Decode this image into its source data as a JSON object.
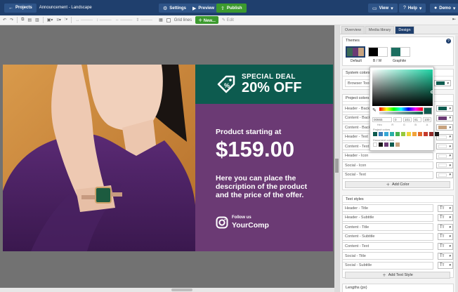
{
  "topbar": {
    "projects_label": "Projects",
    "doc_title": "Announcement - Landscape",
    "settings_label": "Settings",
    "preview_label": "Preview",
    "publish_label": "Publish",
    "view_label": "View",
    "help_label": "Help",
    "user_label": "Demo"
  },
  "toolbar": {
    "grid_lines_label": "Grid lines",
    "new_label": "New...",
    "edit_label": "Edit"
  },
  "artboard": {
    "deal_line1": "SPECIAL DEAL",
    "deal_line2": "20% OFF",
    "product_label": "Product starting at",
    "price": "$159.00",
    "description": "Here you can place the description of the product and the price of the offer.",
    "follow_label": "Follow us",
    "company": "YourComp"
  },
  "panel": {
    "tabs": [
      "Overview",
      "Media library",
      "Design"
    ],
    "active_tab": "Design",
    "themes_title": "Themes",
    "themes": [
      {
        "name": "Default"
      },
      {
        "name": "B / W"
      },
      {
        "name": "Graphite"
      }
    ],
    "system_colors_title": "System colors",
    "system_colors": [
      {
        "label": "Browser Toolba",
        "color": "#0d5b4f"
      }
    ],
    "project_colors_title": "Project colors",
    "project_colors": [
      {
        "label": "Header - Back",
        "color": "#0d5b4f"
      },
      {
        "label": "Content - Back",
        "color": "#6b3a74"
      },
      {
        "label": "Content - Back",
        "color": "#c7a27e"
      },
      {
        "label": "Header - Text",
        "color": "#ffffff"
      },
      {
        "label": "Content - Text",
        "color": "#ffffff"
      },
      {
        "label": "Header - Icon",
        "color": "#ffffff"
      },
      {
        "label": "Social - Icon",
        "color": "#ffffff"
      },
      {
        "label": "Social - Text",
        "color": "#ffffff"
      }
    ],
    "add_color_label": "Add Color",
    "text_styles_title": "Text styles",
    "text_styles": [
      {
        "label": "Header - Title"
      },
      {
        "label": "Header - Subtitle"
      },
      {
        "label": "Content - Title"
      },
      {
        "label": "Content - Subtitle"
      },
      {
        "label": "Content - Text"
      },
      {
        "label": "Social - Title"
      },
      {
        "label": "Social - Subtitle"
      }
    ],
    "add_text_style_label": "Add Text Style",
    "lengths_title": "Lengths (px)"
  },
  "color_picker": {
    "hex_value": "00665",
    "r": "0",
    "g": "101",
    "b": "81",
    "a": "100",
    "hex_caption": "Hex",
    "r_caption": "R",
    "g_caption": "G",
    "b_caption": "B",
    "a_caption": "A",
    "project_colors_caption": "Project colors",
    "document_colors_caption": "Document colors",
    "preset_swatches": [
      "#0d5b4f",
      "#3a7dba",
      "#35a7d6",
      "#2bb0a8",
      "#47b24d",
      "#97c93d",
      "#f0d43a",
      "#f2a33a",
      "#e06a2c",
      "#c73a2c",
      "#8e2a28",
      "#1a1a1a"
    ],
    "doc_swatches": [
      "#ffffff",
      "#1a1a1a",
      "#6b3a74",
      "#0d5b4f",
      "#c7a27e"
    ]
  }
}
